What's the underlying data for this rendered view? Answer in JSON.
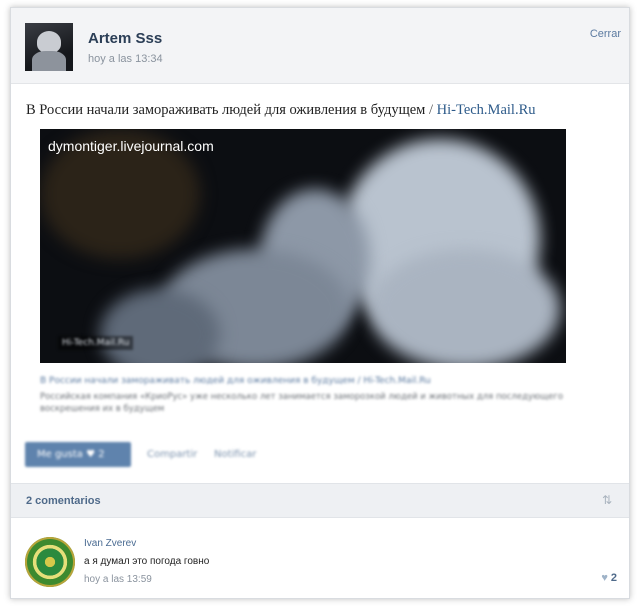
{
  "post": {
    "author": "Artem Sss",
    "time": "hoy a las 13:34",
    "close_label": "Cerrar",
    "text_main": "В России начали замораживать людей для оживления в будущем",
    "text_sep": "/",
    "source_link": "Hi-Tech.Mail.Ru",
    "media": {
      "caption": "dymontiger.livejournal.com",
      "watermark": "Hi-Tech.Mail.Ru"
    },
    "preview": {
      "title": "В России начали замораживать людей для оживления в будущем / Hi-Tech.Mail.Ru",
      "description": "Российская компания «КриоРус» уже несколько лет занимается заморозкой людей и животных для последующего воскрешения их в будущем"
    },
    "actions": {
      "like_label": "Me gusta  ♥  2",
      "share_label": "Compartir",
      "notify_label": "Notificar"
    }
  },
  "comments": {
    "count_label": "2 comentarios",
    "items": [
      {
        "author": "Ivan Zverev",
        "text": "а я думал это погода говно",
        "time": "hoy a las 13:59",
        "likes": "2"
      }
    ]
  },
  "icons": {
    "sort": "sort-icon",
    "heart": "heart-icon"
  },
  "colors": {
    "accent": "#5f83ad",
    "link": "#2e5b8a",
    "header_bg": "#f3f4f6"
  }
}
